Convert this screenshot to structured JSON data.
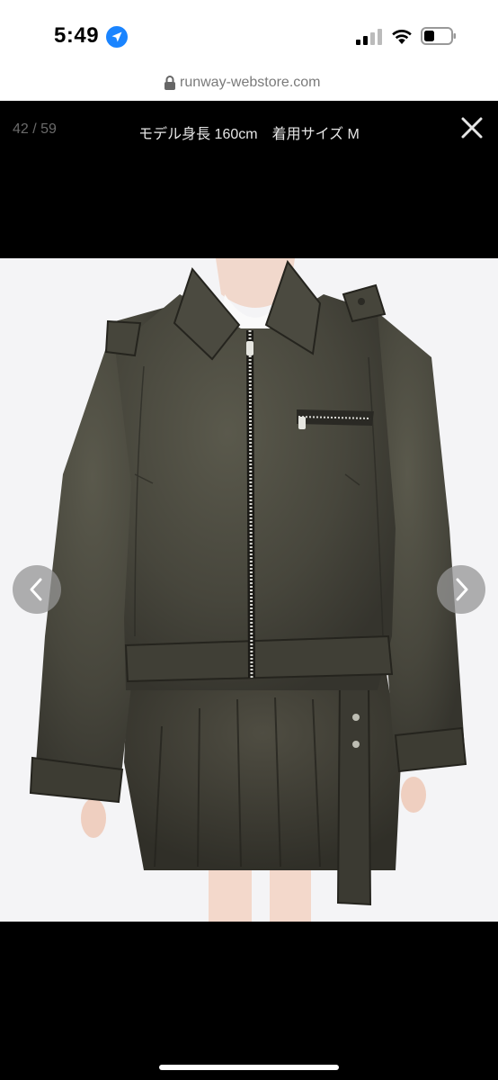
{
  "status_bar": {
    "time": "5:49",
    "icons": [
      "location-arrow-icon",
      "cellular-signal-icon",
      "wifi-icon",
      "battery-icon"
    ]
  },
  "browser": {
    "url": "runway-webstore.com",
    "secure_icon": "lock-icon"
  },
  "gallery": {
    "counter": "42 / 59",
    "caption": "モデル身長 160cm　着用サイズ M",
    "close_icon": "close-icon",
    "prev_icon": "chevron-left-icon",
    "next_icon": "chevron-right-icon"
  },
  "colors": {
    "accent": "#1a84ff",
    "photo_background": "#f4f4f6",
    "garment": "#4a4a40",
    "overlay": "#000000"
  }
}
